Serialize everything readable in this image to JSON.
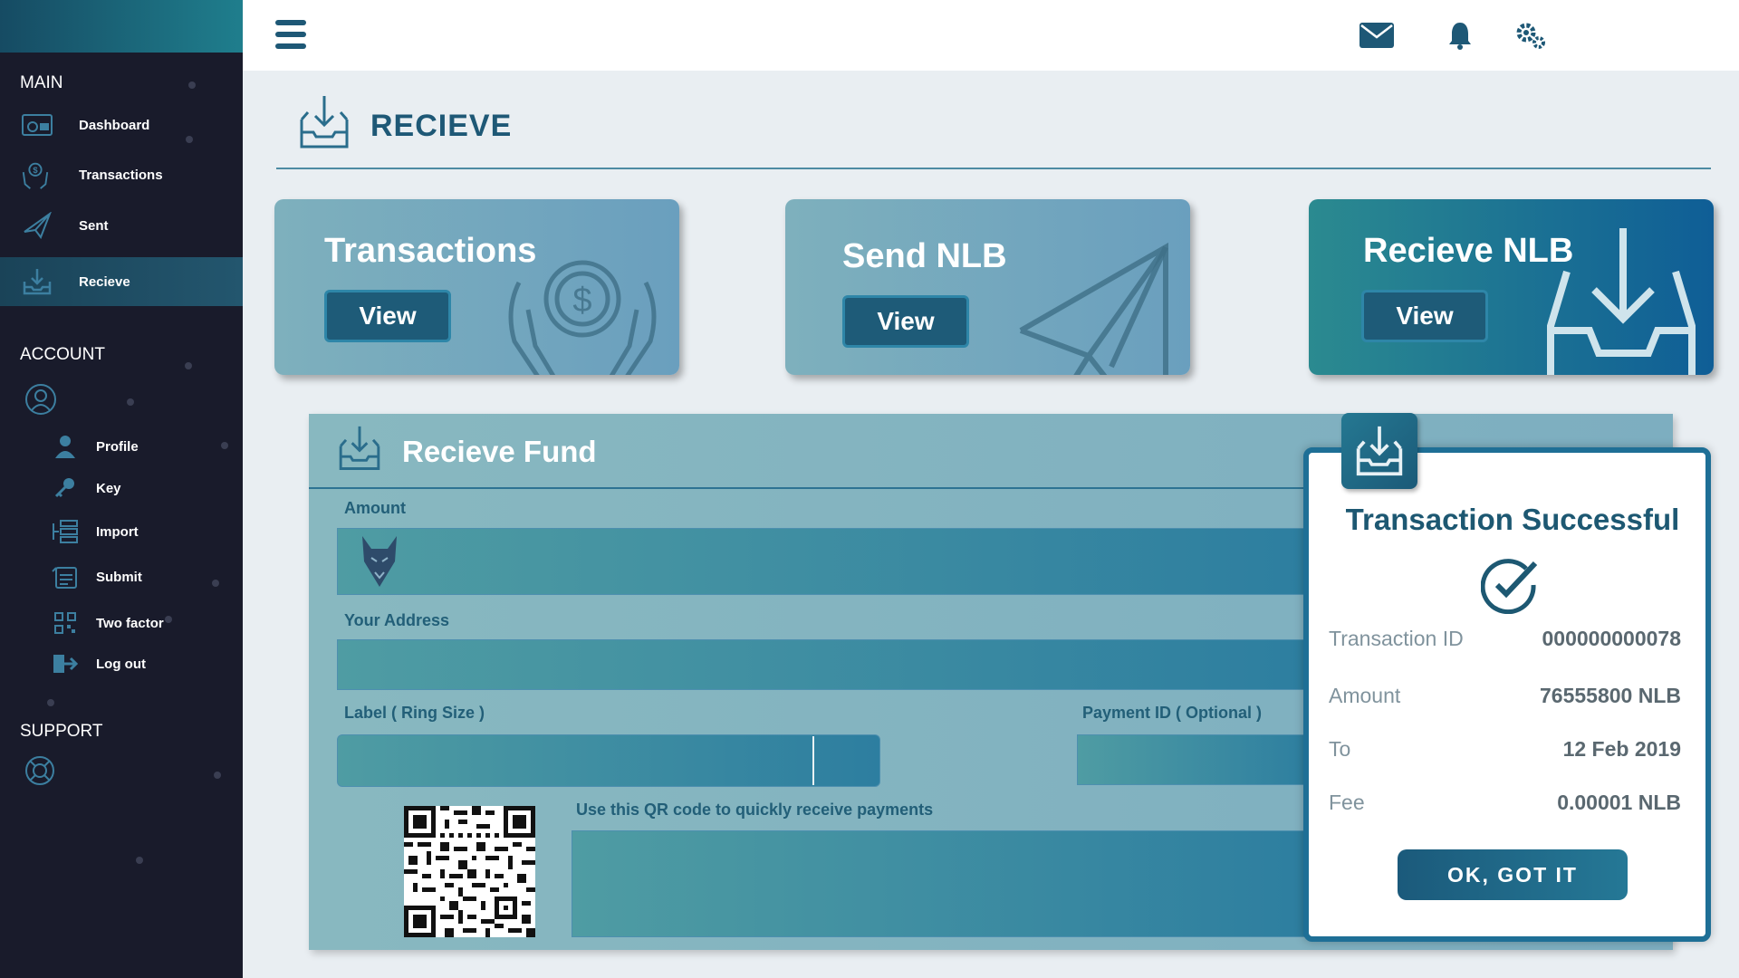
{
  "sidebar": {
    "main_heading": "MAIN",
    "main_items": [
      {
        "label": "Dashboard",
        "icon": "dashboard-icon"
      },
      {
        "label": "Transactions",
        "icon": "coin-hands-icon"
      },
      {
        "label": "Sent",
        "icon": "paper-plane-icon"
      },
      {
        "label": "Recieve",
        "icon": "inbox-download-icon",
        "active": true
      }
    ],
    "account_heading": "ACCOUNT",
    "account_items": [
      {
        "label": "Profile",
        "icon": "user-icon"
      },
      {
        "label": "Key",
        "icon": "key-icon"
      },
      {
        "label": "Import",
        "icon": "import-icon"
      },
      {
        "label": "Submit",
        "icon": "submit-icon"
      },
      {
        "label": "Two factor",
        "icon": "qr-icon"
      },
      {
        "label": "Log out",
        "icon": "logout-icon"
      }
    ],
    "support_heading": "SUPPORT"
  },
  "topbar": {
    "icons": [
      "menu-icon",
      "mail-icon",
      "bell-icon",
      "gears-icon"
    ]
  },
  "page": {
    "title": "RECIEVE"
  },
  "cards": [
    {
      "title": "Transactions",
      "button": "View",
      "art": "coin-hands-icon"
    },
    {
      "title": "Send NLB",
      "button": "View",
      "art": "paper-plane-icon"
    },
    {
      "title": "Recieve NLB",
      "button": "View",
      "art": "inbox-download-icon"
    }
  ],
  "fund": {
    "title": "Recieve Fund",
    "amount_label": "Amount",
    "address_label": "Your Address",
    "label_ring": "Label ( Ring Size )",
    "payment_id": "Payment ID ( Optional )",
    "qr_note": "Use this QR code to quickly receive payments"
  },
  "modal": {
    "title": "Transaction Successful",
    "rows": [
      {
        "label": "Transaction ID",
        "value": "000000000078"
      },
      {
        "label": "Amount",
        "value": "76555800 NLB"
      },
      {
        "label": "To",
        "value": "12 Feb 2019"
      },
      {
        "label": "Fee",
        "value": "0.00001 NLB"
      }
    ],
    "button": "OK, GOT IT"
  },
  "colors": {
    "brand": "#1e5876",
    "sidebar": "#191b2b",
    "accent": "#2e86a8"
  }
}
